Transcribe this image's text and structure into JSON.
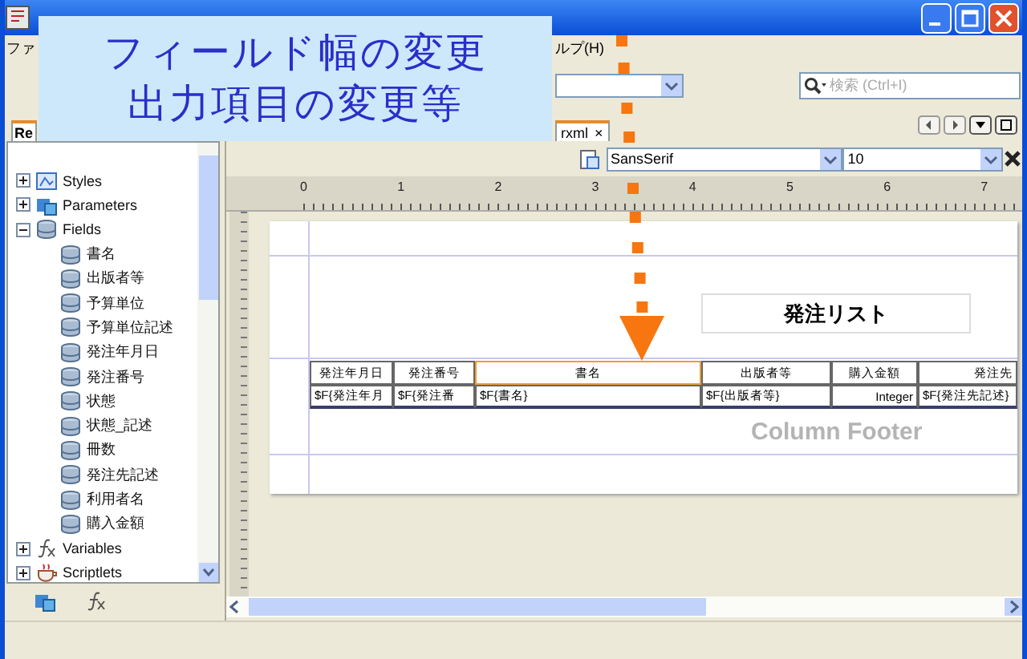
{
  "menu": [
    "ファ",
    "ルプ(H)"
  ],
  "toolbar": {
    "search": {
      "placeholder": "検索 (Ctrl+I)"
    }
  },
  "tabs": [
    {
      "label": "Re",
      "kind": "panel",
      "selected": true
    },
    {
      "label": "rxml",
      "kind": "document",
      "selected": true,
      "close": "×"
    }
  ],
  "tree": [
    {
      "label": "Styles",
      "kind": "styles",
      "expanded": false
    },
    {
      "label": "Parameters",
      "kind": "parameters",
      "expanded": false
    },
    {
      "label": "Fields",
      "kind": "fields",
      "expanded": true,
      "children": [
        {
          "label": "書名"
        },
        {
          "label": "出版者等"
        },
        {
          "label": "予算単位"
        },
        {
          "label": "予算単位記述"
        },
        {
          "label": "発注年月日"
        },
        {
          "label": "発注番号"
        },
        {
          "label": "状態"
        },
        {
          "label": "状態_記述"
        },
        {
          "label": "冊数"
        },
        {
          "label": "発注先記述"
        },
        {
          "label": "利用者名"
        },
        {
          "label": "購入金額"
        }
      ]
    },
    {
      "label": "Variables",
      "kind": "variables",
      "expanded": false
    },
    {
      "label": "Scriptlets",
      "kind": "scriptlets",
      "expanded": false
    }
  ],
  "format_bar": {
    "font": "SansSerif",
    "size": "10"
  },
  "ruler": [
    "0",
    "1",
    "2",
    "3",
    "4",
    "5",
    "6",
    "7"
  ],
  "report": {
    "title": "発注リスト",
    "column_header": [
      {
        "text": "発注年月日",
        "selected": false
      },
      {
        "text": "発注番号",
        "selected": false
      },
      {
        "text": "書名",
        "selected": true
      },
      {
        "text": "出版者等",
        "selected": false
      },
      {
        "text": "購入金額",
        "selected": false
      },
      {
        "text": "発注先",
        "selected": false
      }
    ],
    "detail": [
      {
        "text": "$F{発注年月",
        "kind": "field"
      },
      {
        "text": "$F{発注番",
        "kind": "field"
      },
      {
        "text": "$F{書名}",
        "kind": "field"
      },
      {
        "text": "$F{出版者等}",
        "kind": "field"
      },
      {
        "text": "Integer",
        "kind": "expression"
      },
      {
        "text": "$F{発注先記述}",
        "kind": "field"
      }
    ],
    "band_label": "Column Footer"
  },
  "callout": {
    "lines": [
      "フィールド幅の変更",
      "出力項目の変更等"
    ]
  }
}
